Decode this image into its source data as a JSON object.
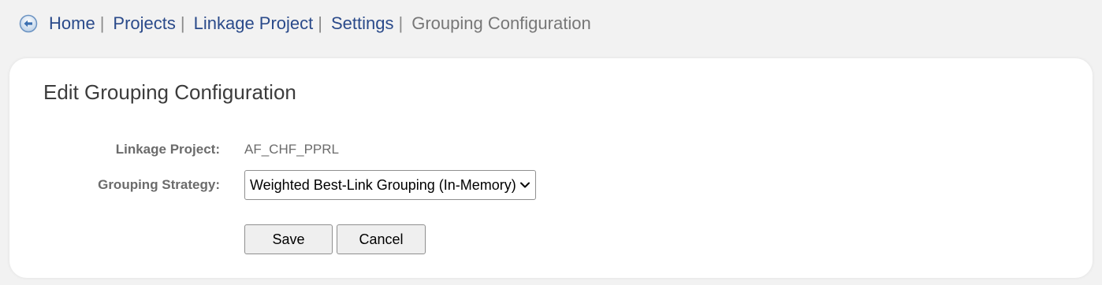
{
  "breadcrumb": {
    "items": [
      {
        "label": "Home"
      },
      {
        "label": "Projects"
      },
      {
        "label": "Linkage Project"
      },
      {
        "label": "Settings"
      }
    ],
    "separator": "|",
    "current": "Grouping Configuration",
    "back_icon": "circle-arrow-left-icon"
  },
  "form": {
    "title": "Edit Grouping Configuration",
    "linkage_project_label": "Linkage Project:",
    "linkage_project_value": "AF_CHF_PPRL",
    "grouping_strategy_label": "Grouping Strategy:",
    "grouping_strategy_value": "Weighted Best-Link Grouping (In-Memory)",
    "save_label": "Save",
    "cancel_label": "Cancel"
  },
  "colors": {
    "link": "#2a4a8a",
    "background": "#f2f2f2",
    "card": "#ffffff"
  }
}
